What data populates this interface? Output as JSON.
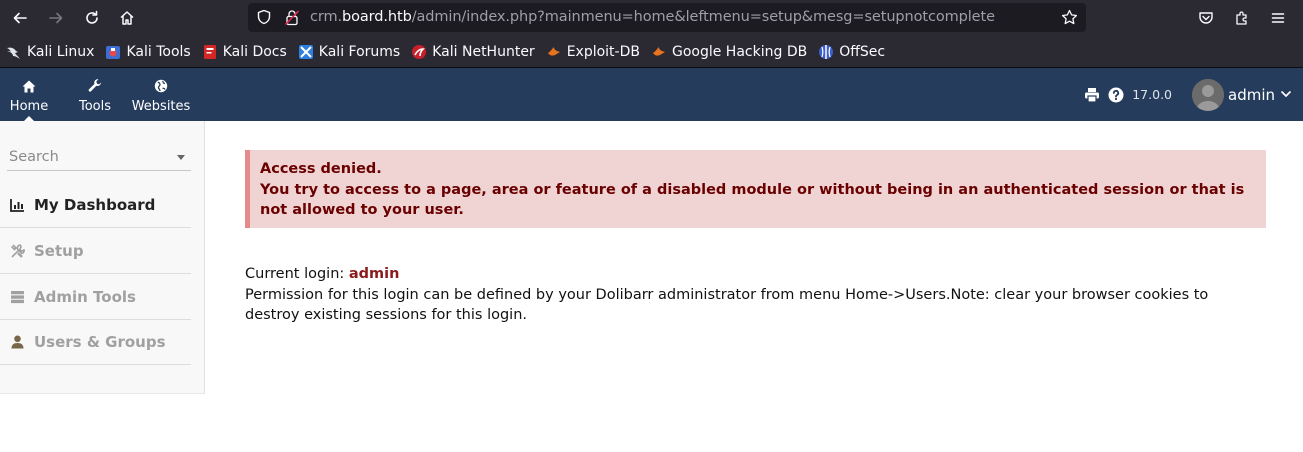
{
  "browser": {
    "url_prefix": "crm.",
    "url_domain": "board.htb",
    "url_path": "/admin/index.php?mainmenu=home&leftmenu=setup&mesg=setupnotcomplete",
    "bookmarks": [
      {
        "label": "Kali Linux",
        "icon": "kali-dragon-icon"
      },
      {
        "label": "Kali Tools",
        "icon": "kali-tools-icon"
      },
      {
        "label": "Kali Docs",
        "icon": "kali-docs-icon"
      },
      {
        "label": "Kali Forums",
        "icon": "kali-forums-icon"
      },
      {
        "label": "Kali NetHunter",
        "icon": "nethunter-icon"
      },
      {
        "label": "Exploit-DB",
        "icon": "exploit-db-icon"
      },
      {
        "label": "Google Hacking DB",
        "icon": "ghdb-icon"
      },
      {
        "label": "OffSec",
        "icon": "offsec-icon"
      }
    ]
  },
  "topnav": {
    "home": "Home",
    "tools": "Tools",
    "websites": "Websites",
    "version": "17.0.0",
    "user": "admin"
  },
  "sidebar": {
    "search_placeholder": "Search",
    "items": [
      {
        "label": "My Dashboard",
        "active": true
      },
      {
        "label": "Setup",
        "active": false
      },
      {
        "label": "Admin Tools",
        "active": false
      },
      {
        "label": "Users & Groups",
        "active": false
      }
    ]
  },
  "alert": {
    "title": "Access denied.",
    "message": "You try to access to a page, area or feature of a disabled module or without being in an authenticated session or that is not allowed to your user."
  },
  "info": {
    "current_login_label": "Current login:",
    "current_login_value": "admin",
    "permission_text": "Permission for this login can be defined by your Dolibarr administrator from menu Home->Users.Note: clear your browser cookies to destroy existing sessions for this login."
  },
  "colors": {
    "topbar": "#263c5c",
    "alert_bg": "#f0d4d4",
    "alert_text": "#6a0000",
    "login_value": "#8b1c1c"
  }
}
